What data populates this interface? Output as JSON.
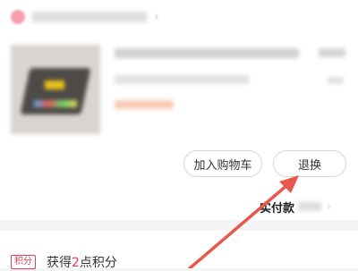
{
  "order": {
    "actions": {
      "add_to_cart": "加入购物车",
      "return_exchange": "退换"
    },
    "payment": {
      "label": "实付款"
    }
  },
  "points": {
    "badge": "积分",
    "prefix": "获得",
    "count": "2",
    "suffix": "点积分"
  },
  "colors": {
    "accent_red": "#e23e57",
    "annotation_arrow": "#e8574c"
  }
}
